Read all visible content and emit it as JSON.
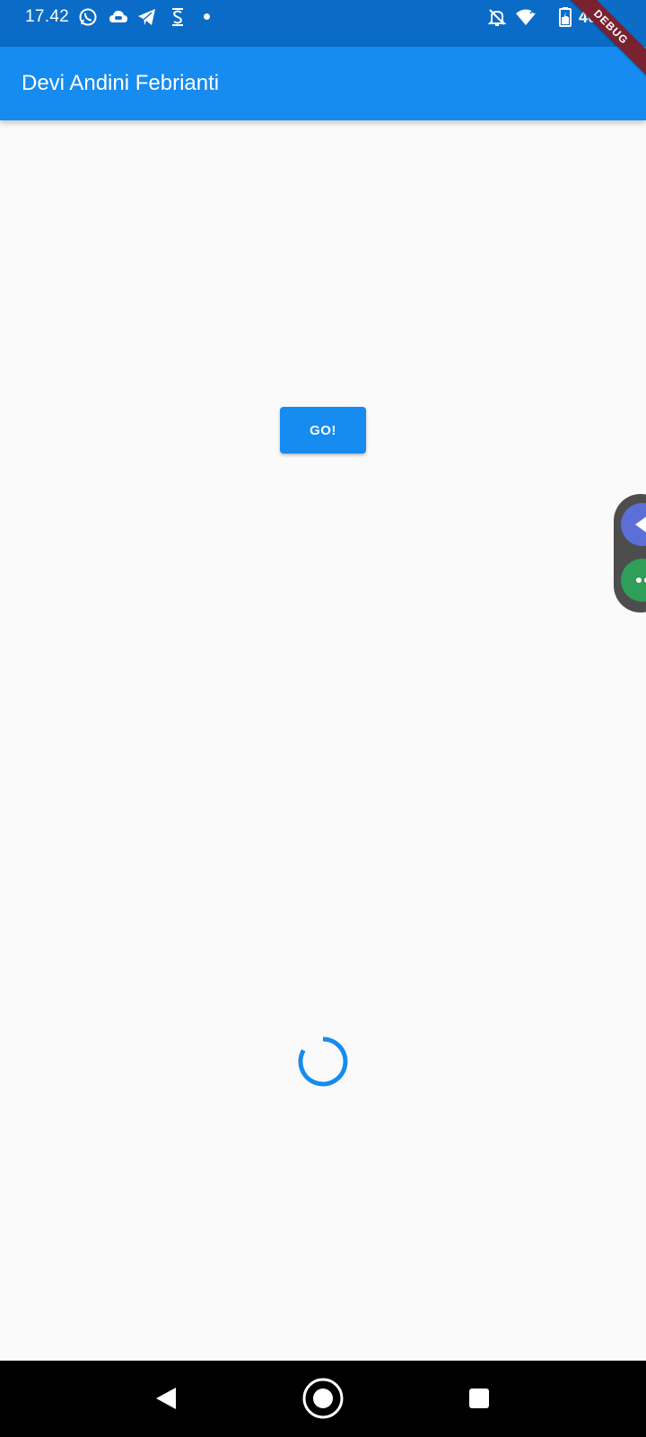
{
  "status_bar": {
    "time": "17.42",
    "battery_percent": "46%",
    "notification_icons": [
      "whatsapp-icon",
      "cloud-game-icon",
      "telegram-icon",
      "s-app-icon",
      "more-dot"
    ],
    "system_icons": [
      "mute-bell-icon",
      "wifi-icon",
      "battery-icon"
    ]
  },
  "app_bar": {
    "title": "Devi Andini Febrianti"
  },
  "debug_banner": {
    "label": "DEBUG"
  },
  "main": {
    "go_button_label": "GO!",
    "loading": true
  },
  "side_widget": {
    "buttons": [
      "back-arrow-icon",
      "more-dots-icon"
    ]
  },
  "nav_bar": {
    "buttons": [
      "back-button",
      "home-button",
      "recents-button"
    ]
  },
  "colors": {
    "status_bar": "#0b6cc7",
    "app_bar": "#168bf0",
    "accent": "#168bf0",
    "background": "#fafafa",
    "debug_ribbon": "#7a2230",
    "nav_bar": "#000000"
  }
}
